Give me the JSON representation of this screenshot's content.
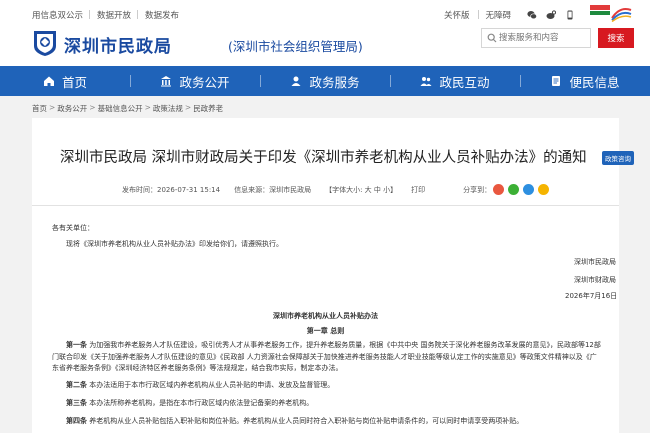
{
  "topbar": {
    "links": [
      "用信息双公示",
      "数据开放",
      "数据发布"
    ],
    "right_links": [
      "关怀版",
      "无障碍"
    ],
    "icons": [
      "wechat-icon",
      "weibo-icon",
      "mobile-icon"
    ]
  },
  "header": {
    "site_title": "深圳市民政局",
    "site_subtitle": "(深圳市社会组织管理局)",
    "search_placeholder": "搜索服务和内容",
    "search_button": "搜索"
  },
  "nav": [
    {
      "label": "首页",
      "icon": "home-icon"
    },
    {
      "label": "政务公开",
      "icon": "building-icon"
    },
    {
      "label": "政务服务",
      "icon": "service-icon"
    },
    {
      "label": "政民互动",
      "icon": "people-icon"
    },
    {
      "label": "便民信息",
      "icon": "doc-icon"
    }
  ],
  "breadcrumbs": [
    "首页",
    "政务公开",
    "基础信息公开",
    "政策法规",
    "民政养老"
  ],
  "article": {
    "title": "深圳市民政局 深圳市财政局关于印发《深圳市养老机构从业人员补贴办法》的通知",
    "badge": "政策咨询",
    "meta_date": "发布时间：2026-07-31 15:14",
    "meta_source": "信息来源：深圳市民政局",
    "meta_font": "【字体大小: 大 中 小】",
    "meta_print": "打印",
    "meta_share": "分享到：",
    "salutation": "各有关单位：",
    "intro": "现将《深圳市养老机构从业人员补贴办法》印发给你们，请遵照执行。",
    "sign1": "深圳市民政局",
    "sign2": "深圳市财政局",
    "sign_date": "2026年7月16日",
    "doc_title": "深圳市养老机构从业人员补贴办法",
    "chapter": "第一章  总则",
    "art1_label": "第一条",
    "art1_text": "为加强我市养老服务人才队伍建设，吸引优秀人才从事养老服务工作，提升养老服务质量，根据《中共中央 国务院关于深化养老服务改革发展的意见》，民政部等12部门联合印发《关于加强养老服务人才队伍建设的意见》《民政部 人力资源社会保障部关于加快推进养老服务技能人才职业技能等级认定工作的实施意见》等政策文件精神以及《广东省养老服务条例》《深圳经济特区养老服务条例》等法规规定，结合我市实际，制定本办法。",
    "art2_label": "第二条",
    "art2_text": "本办法适用于本市行政区域内养老机构从业人员补贴的申请、发放及监督管理。",
    "art3_label": "第三条",
    "art3_text": "本办法所称养老机构，是指在本市行政区域内依法登记备案的养老机构。",
    "art4_label": "第四条",
    "art4_text": "养老机构从业人员补贴包括入职补贴和岗位补贴。养老机构从业人员同时符合入职补贴与岗位补贴申请条件的，可以同时申请享受两项补贴。"
  },
  "colors": {
    "brand_blue": "#1f63b9",
    "search_red": "#d71920"
  }
}
